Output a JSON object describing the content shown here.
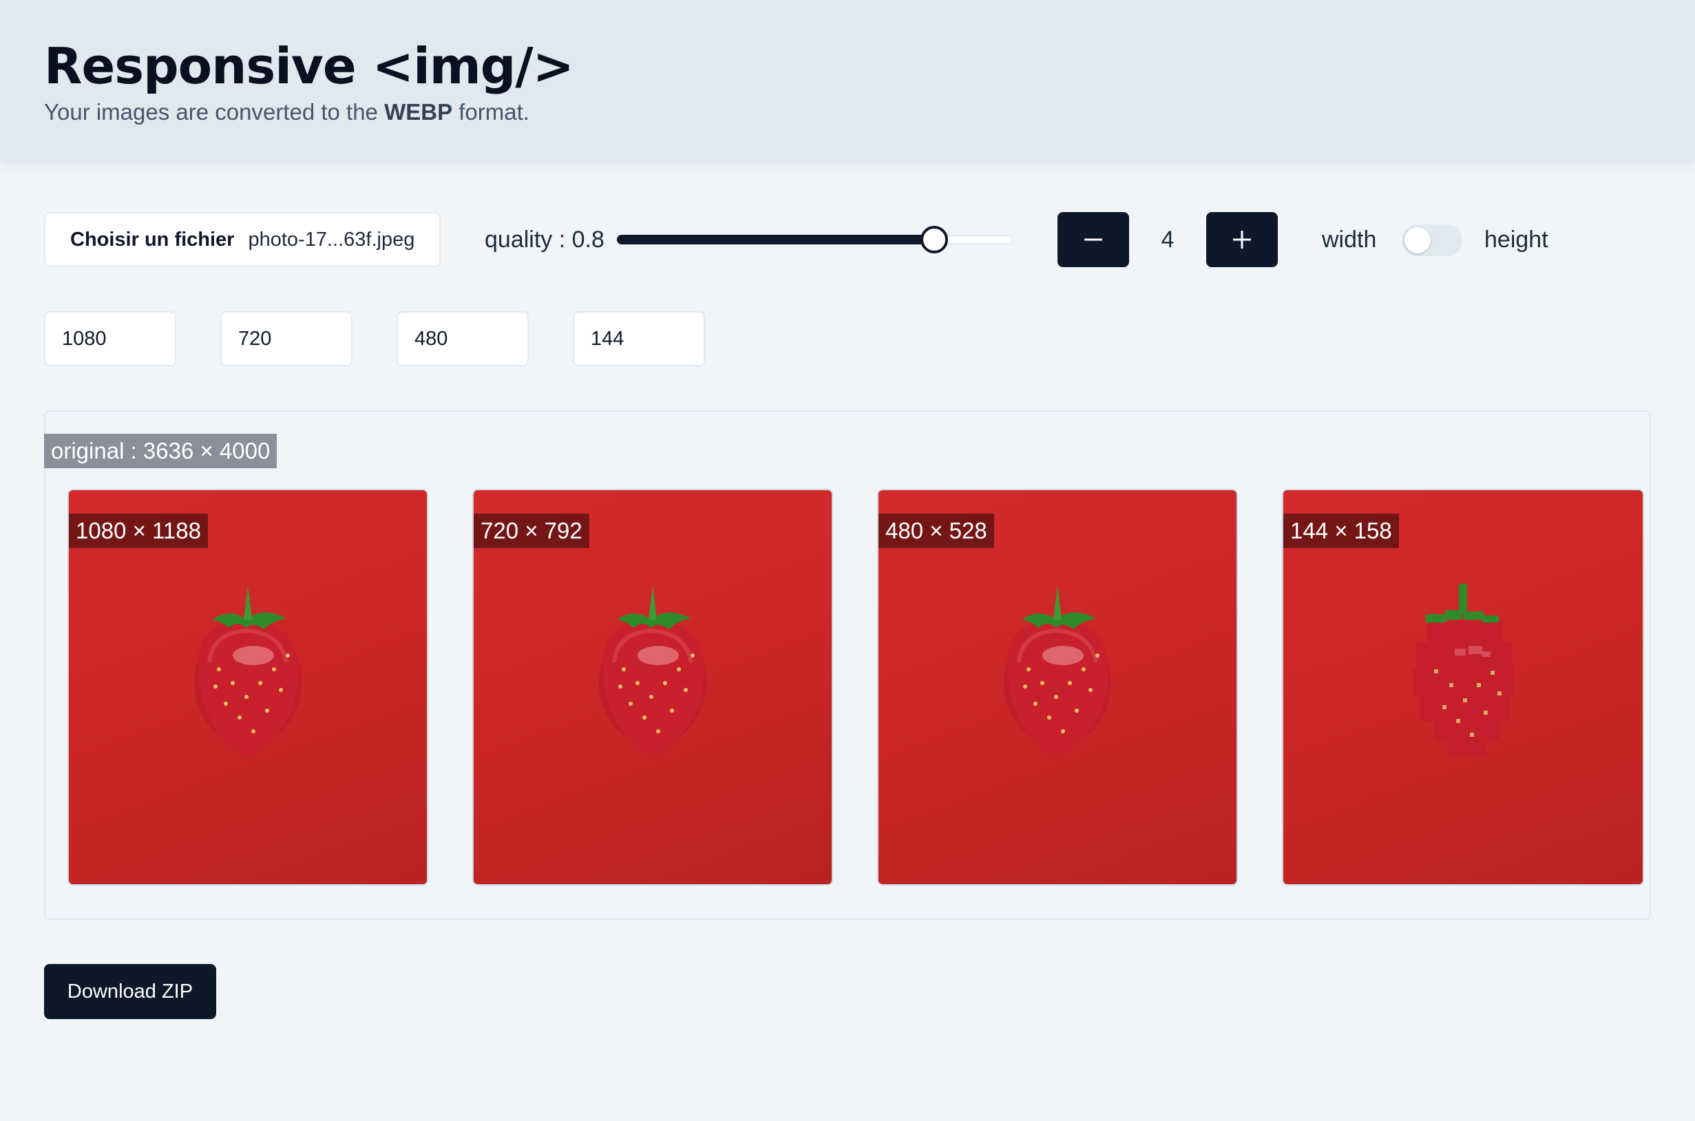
{
  "header": {
    "title": "Responsive <img/>",
    "subtitle_prefix": "Your images are converted to the ",
    "subtitle_format": "WEBP",
    "subtitle_suffix": " format."
  },
  "controls": {
    "file_button_label": "Choisir un fichier",
    "file_name": "photo-17...63f.jpeg",
    "quality_label": "quality : 0.8",
    "quality_value": 0.8,
    "count": "4",
    "toggle_left_label": "width",
    "toggle_right_label": "height",
    "toggle_on": false
  },
  "sizes": [
    "1080",
    "720",
    "480",
    "144"
  ],
  "preview": {
    "original_label": "original : 3636 × 4000",
    "images": [
      {
        "label": "1080 × 1188"
      },
      {
        "label": "720 × 792"
      },
      {
        "label": "480 × 528"
      },
      {
        "label": "144 × 158"
      }
    ]
  },
  "actions": {
    "download_label": "Download ZIP"
  },
  "colors": {
    "primary": "#0f172a",
    "header_bg": "#e2e8f0",
    "page_bg": "#f1f5f9",
    "image_red": "#cc2727"
  },
  "icons": {
    "decrement": "minus-icon",
    "increment": "plus-icon",
    "image_subject": "strawberry-image"
  }
}
